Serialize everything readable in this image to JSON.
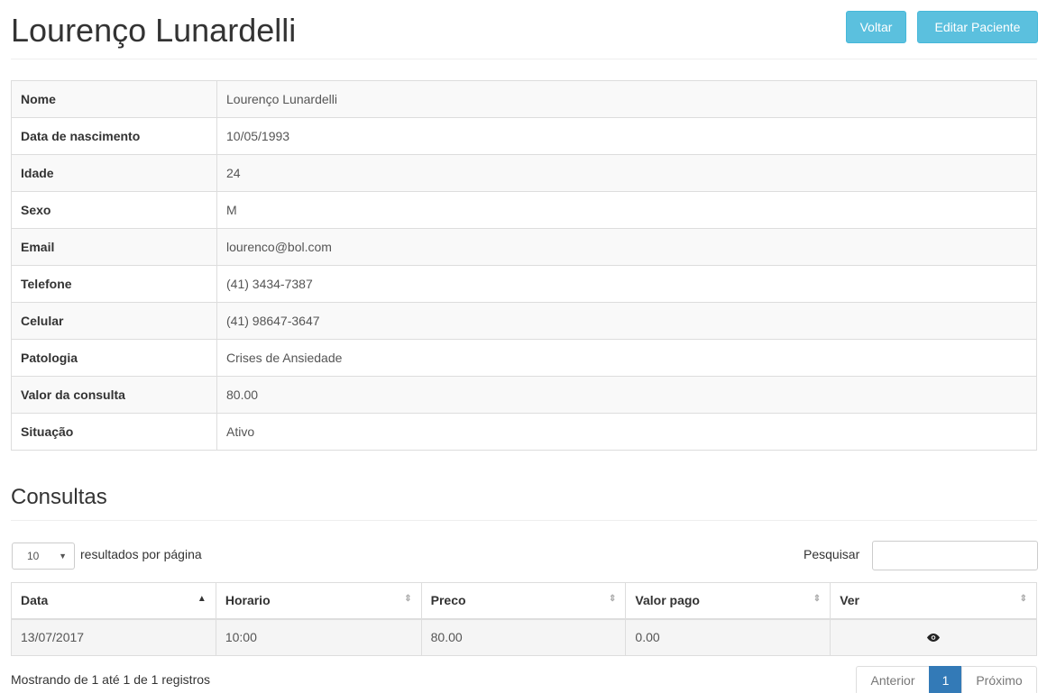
{
  "header": {
    "title": "Lourenço Lunardelli",
    "btn_voltar": "Voltar",
    "btn_editar": "Editar Paciente"
  },
  "details": [
    {
      "label": "Nome",
      "value": "Lourenço Lunardelli"
    },
    {
      "label": "Data de nascimento",
      "value": "10/05/1993"
    },
    {
      "label": "Idade",
      "value": "24"
    },
    {
      "label": "Sexo",
      "value": "M"
    },
    {
      "label": "Email",
      "value": "lourenco@bol.com"
    },
    {
      "label": "Telefone",
      "value": "(41) 3434-7387"
    },
    {
      "label": "Celular",
      "value": "(41) 98647-3647"
    },
    {
      "label": "Patologia",
      "value": "Crises de Ansiedade"
    },
    {
      "label": "Valor da consulta",
      "value": "80.00"
    },
    {
      "label": "Situação",
      "value": "Ativo"
    }
  ],
  "consultas": {
    "title": "Consultas",
    "page_length": "10",
    "page_length_label": "resultados por página",
    "search_label": "Pesquisar",
    "search_value": "",
    "columns": [
      "Data",
      "Horario",
      "Preco",
      "Valor pago",
      "Ver"
    ],
    "rows": [
      {
        "data": "13/07/2017",
        "horario": "10:00",
        "preco": "80.00",
        "valor_pago": "0.00",
        "ver_icon": "eye-icon"
      }
    ],
    "info": "Mostrando de 1 até 1 de 1 registros",
    "pagination": {
      "prev": "Anterior",
      "current": "1",
      "next": "Próximo"
    }
  },
  "colors": {
    "info_button": "#5bc0de",
    "active_page": "#337ab7"
  }
}
